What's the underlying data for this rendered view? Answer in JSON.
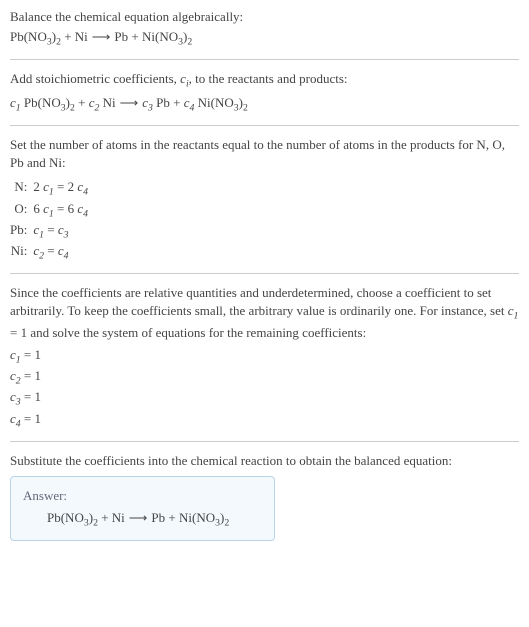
{
  "sections": {
    "intro": {
      "line1": "Balance the chemical equation algebraically:"
    },
    "stoich": {
      "line1": "Add stoichiometric coefficients, ",
      "ci": "c",
      "isub": "i",
      "line1b": ", to the reactants and products:"
    },
    "atoms": {
      "line1": "Set the number of atoms in the reactants equal to the number of atoms in the products for N, O, Pb and Ni:",
      "rows": [
        {
          "el": "N:",
          "eq_lhs_coef": "2 ",
          "eq_lhs_c": "c",
          "eq_lhs_sub": "1",
          "eq_mid": " = 2 ",
          "eq_rhs_c": "c",
          "eq_rhs_sub": "4"
        },
        {
          "el": "O:",
          "eq_lhs_coef": "6 ",
          "eq_lhs_c": "c",
          "eq_lhs_sub": "1",
          "eq_mid": " = 6 ",
          "eq_rhs_c": "c",
          "eq_rhs_sub": "4"
        },
        {
          "el": "Pb:",
          "eq_lhs_coef": "",
          "eq_lhs_c": "c",
          "eq_lhs_sub": "1",
          "eq_mid": " = ",
          "eq_rhs_c": "c",
          "eq_rhs_sub": "3"
        },
        {
          "el": "Ni:",
          "eq_lhs_coef": "",
          "eq_lhs_c": "c",
          "eq_lhs_sub": "2",
          "eq_mid": " = ",
          "eq_rhs_c": "c",
          "eq_rhs_sub": "4"
        }
      ]
    },
    "choose": {
      "line1a": "Since the coefficients are relative quantities and underdetermined, choose a coefficient to set arbitrarily. To keep the coefficients small, the arbitrary value is ordinarily one. For instance, set ",
      "c": "c",
      "sub": "1",
      "line1b": " = 1 and solve the system of equations for the remaining coefficients:",
      "coefs": [
        {
          "c": "c",
          "sub": "1",
          "val": " = 1"
        },
        {
          "c": "c",
          "sub": "2",
          "val": " = 1"
        },
        {
          "c": "c",
          "sub": "3",
          "val": " = 1"
        },
        {
          "c": "c",
          "sub": "4",
          "val": " = 1"
        }
      ]
    },
    "subst": {
      "line1": "Substitute the coefficients into the chemical reaction to obtain the balanced equation:"
    },
    "answer": {
      "label": "Answer:"
    }
  },
  "eq": {
    "pbno3": {
      "a": "Pb(NO",
      "s1": "3",
      "b": ")",
      "s2": "2"
    },
    "plus": " + ",
    "ni": "Ni",
    "arrow": "⟶",
    "pb": "Pb",
    "nino3": {
      "a": "Ni(NO",
      "s1": "3",
      "b": ")",
      "s2": "2"
    },
    "c": "c",
    "sp": " "
  }
}
